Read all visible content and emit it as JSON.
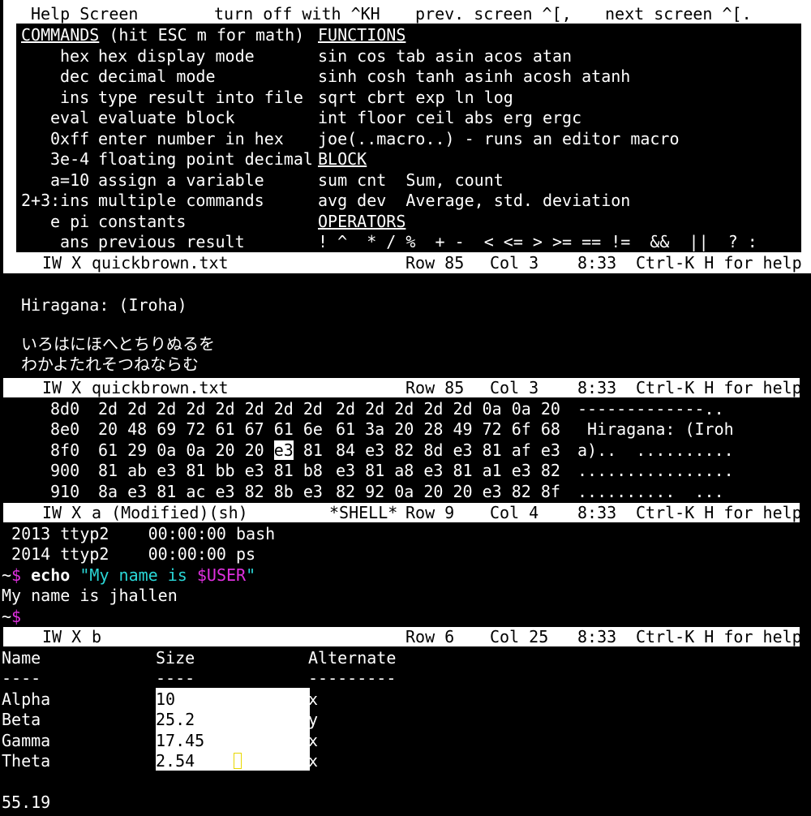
{
  "help": {
    "top_bar": {
      "title": "Help Screen",
      "toggle": "turn off with ^KH",
      "prev": "prev. screen ^[,",
      "next": "next screen ^[."
    },
    "commands_header": "COMMANDS",
    "commands_header_suffix": " (hit ESC m for math)",
    "functions_header": "FUNCTIONS",
    "block_header": "BLOCK",
    "operators_header": "OPERATORS",
    "commands": [
      {
        "key": "hex",
        "desc": "hex display mode"
      },
      {
        "key": "dec",
        "desc": "decimal mode"
      },
      {
        "key": "ins",
        "desc": "type result into file"
      },
      {
        "key": "eval",
        "desc": "evaluate block"
      },
      {
        "key": "0xff",
        "desc": "enter number in hex"
      },
      {
        "key": "3e-4",
        "desc": "floating point decimal"
      },
      {
        "key": "a=10",
        "desc": "assign a variable"
      },
      {
        "key": "2+3:ins",
        "desc": "multiple commands"
      },
      {
        "key": "e pi",
        "desc": "constants"
      },
      {
        "key": "ans",
        "desc": "previous result"
      }
    ],
    "functions": [
      "sin cos tab asin acos atan",
      "sinh cosh tanh asinh acosh atanh",
      "sqrt cbrt exp ln log",
      "int floor ceil abs erg ergc",
      "joe(..macro..) - runs an editor macro"
    ],
    "block": [
      "sum cnt  Sum, count",
      "avg dev  Average, std. deviation"
    ],
    "operators": "! ^  * / %  + -  < <= > >= == !=  &&  ||  ? :"
  },
  "status1": {
    "flags": "IW X",
    "file": "quickbrown.txt",
    "row": "Row 85",
    "col": "Col 3",
    "time": "8:33",
    "help": "Ctrl-K H for help"
  },
  "text_window": {
    "heading": "Hiragana: (Iroha)",
    "line1": "いろはにほへとちりぬるを",
    "line2": "わかよたれそつねならむ"
  },
  "status2": {
    "flags": "IW X",
    "file": "quickbrown.txt",
    "row": "Row 85",
    "col": "Col 3",
    "time": "8:33",
    "help": "Ctrl-K H for help"
  },
  "hex": {
    "rows": [
      {
        "addr": "8d0",
        "a": "2d 2d 2d 2d 2d 2d 2d 2d",
        "b": "2d 2d 2d 2d 2d 0a 0a 20",
        "ascii": "-------------.."
      },
      {
        "addr": "8e0",
        "a": "20 48 69 72 61 67 61 6e",
        "b": "61 3a 20 28 49 72 6f 68",
        "ascii": " Hiragana: (Iroh"
      },
      {
        "addr": "8f0",
        "a1": "61 29 0a 0a 20 20 ",
        "cursor": "e3",
        "a2": " 81",
        "b": "84 e3 82 8d e3 81 af e3",
        "ascii": "a)..  .........."
      },
      {
        "addr": "900",
        "a": "81 ab e3 81 bb e3 81 b8",
        "b": "e3 81 a8 e3 81 a1 e3 82",
        "ascii": "................"
      },
      {
        "addr": "910",
        "a": "8a e3 81 ac e3 82 8b e3",
        "b": "82 92 0a 20 20 e3 82 8f",
        "ascii": "..........  ..."
      }
    ]
  },
  "status3": {
    "flags": "IW X",
    "file": "a (Modified)(sh)",
    "shell": "*SHELL*",
    "row": "Row 9",
    "col": "Col 4",
    "time": "8:33",
    "help": "Ctrl-K H for help"
  },
  "shell": {
    "ps1": " 2013 ttyp2    00:00:00 bash",
    "ps2": " 2014 ttyp2    00:00:00 ps",
    "prompt_tilde": "~",
    "prompt_dollar": "$",
    "cmd": "echo",
    "arg_prefix": "\"My name is ",
    "arg_var": "$USER",
    "arg_suffix": "\"",
    "output": "My name is jhallen"
  },
  "status4": {
    "flags": "IW X",
    "file": "b",
    "row": "Row 6",
    "col": "Col 25",
    "time": "8:33",
    "help": "Ctrl-K H for help"
  },
  "table": {
    "headers": [
      "Name",
      "Size",
      "Alternate"
    ],
    "dashes": [
      "----",
      "----",
      "---------"
    ],
    "rows": [
      {
        "name": "Alpha",
        "size": "10",
        "alt": "x"
      },
      {
        "name": "Beta",
        "size": "25.2",
        "alt": "y"
      },
      {
        "name": "Gamma",
        "size": "17.45",
        "alt": "x"
      },
      {
        "name": "Theta",
        "size": "2.54",
        "alt": "x"
      }
    ],
    "result": "55.19"
  }
}
